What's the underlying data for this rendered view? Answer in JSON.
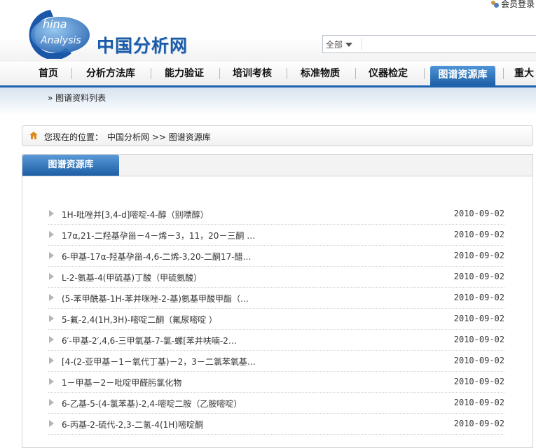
{
  "header": {
    "login_text": "会员登录",
    "logo_latin_1": "hina",
    "logo_latin_2": "Analysis",
    "logo_cn": "中国分析网",
    "search_scope": "全部"
  },
  "nav": {
    "items": [
      {
        "label": "首页"
      },
      {
        "label": "分析方法库"
      },
      {
        "label": "能力验证"
      },
      {
        "label": "培训考核"
      },
      {
        "label": "标准物质"
      },
      {
        "label": "仪器检定"
      },
      {
        "label": "图谱资源库"
      },
      {
        "label": "重大"
      }
    ],
    "active_index": 6,
    "sub_item": "» 图谱资料列表"
  },
  "breadcrumb": {
    "prefix": "您现在的位置：",
    "path": "中国分析网 >> 图谱资源库"
  },
  "panel": {
    "tab_label": "图谱资源库",
    "rows": [
      {
        "title": "1H-吡唑并[3,4-d]嘧啶-4-醇（别嘌醇）",
        "date": "2010-09-02"
      },
      {
        "title": "17α,21-二羟基孕甾－4－烯－3，11，20－三酮 …",
        "date": "2010-09-02"
      },
      {
        "title": "6-甲基-17α-羟基孕甾-4,6-二烯-3,20-二酮17-醋…",
        "date": "2010-09-02"
      },
      {
        "title": "L-2-氨基-4(甲硫基)丁酸（甲硫氨酸）",
        "date": "2010-09-02"
      },
      {
        "title": "(5-苯甲酰基-1H-苯并咪唑-2-基)氨基甲酸甲酯（…",
        "date": "2010-09-02"
      },
      {
        "title": "5-氟-2,4(1H,3H)-嘧啶二酮（氟尿嘧啶 ）",
        "date": "2010-09-02"
      },
      {
        "title": "6′-甲基-2′,4,6-三甲氧基-7-氯-螺[苯并呋喃-2…",
        "date": "2010-09-02"
      },
      {
        "title": "[4-(2-亚甲基－1－氧代丁基)－2，3－二氯苯氧基…",
        "date": "2010-09-02"
      },
      {
        "title": "1－甲基－2－吡啶甲醛肟氯化物",
        "date": "2010-09-02"
      },
      {
        "title": "6-乙基-5-(4-氯苯基)-2,4-嘧啶二胺（乙胺嘧啶）",
        "date": "2010-09-02"
      },
      {
        "title": "6-丙基-2-硫代-2,3-二氢-4(1H)嘧啶酮",
        "date": "2010-09-02"
      }
    ]
  }
}
